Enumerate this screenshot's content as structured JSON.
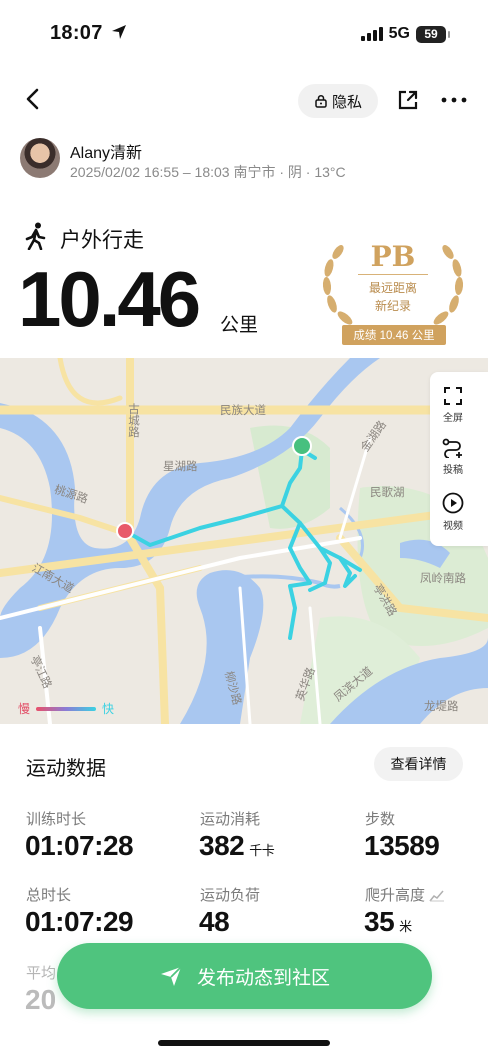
{
  "status_bar": {
    "time": "18:07",
    "network": "5G",
    "battery": "59"
  },
  "nav": {
    "privacy_label": "隐私"
  },
  "user": {
    "name": "Alany清新",
    "meta": "2025/02/02 16:55 – 18:03 南宁市 · 阴 · 13°C"
  },
  "sport": {
    "type": "户外行走",
    "distance": "10.46",
    "distance_unit": "公里"
  },
  "pb_badge": {
    "title": "PB",
    "line1": "最远距离",
    "line2": "新纪录",
    "result": "成绩 10.46 公里"
  },
  "map": {
    "tools": [
      {
        "label": "全屏",
        "icon": "fullscreen-icon"
      },
      {
        "label": "投稿",
        "icon": "route-submit-icon"
      },
      {
        "label": "视频",
        "icon": "play-video-icon"
      }
    ],
    "pace_legend": {
      "slow": "慢",
      "fast": "快"
    },
    "labels": {
      "minzu": "民族大道",
      "gucheng": "古城路",
      "xinghu": "星湖路",
      "taoyuan": "桃源路",
      "minge": "民歌湖",
      "jinhu": "金湖路",
      "fengling": "凤岭南路",
      "jiangnan": "江南大道",
      "tingjiang": "亭江路",
      "tinghong": "亭洪路",
      "liusha": "柳沙路",
      "yinghua": "英华路",
      "fengbin": "凤滨大道",
      "longti": "龙堤路"
    }
  },
  "stats": {
    "title": "运动数据",
    "detail_button": "查看详情",
    "items": [
      {
        "label": "训练时长",
        "value": "01:07:28",
        "unit": ""
      },
      {
        "label": "运动消耗",
        "value": "382",
        "unit": "千卡"
      },
      {
        "label": "步数",
        "value": "13589",
        "unit": ""
      },
      {
        "label": "总时长",
        "value": "01:07:29",
        "unit": ""
      },
      {
        "label": "运动负荷",
        "value": "48",
        "unit": ""
      },
      {
        "label": "爬升高度",
        "value": "35",
        "unit": "米"
      }
    ],
    "partial_label": "平均",
    "partial_value": "20"
  },
  "publish_button": "发布动态到社区",
  "colors": {
    "accent_green": "#4fc47e",
    "pb_gold": "#d0a25e",
    "route": "#3bd2e2",
    "water": "#a9c7f0"
  }
}
